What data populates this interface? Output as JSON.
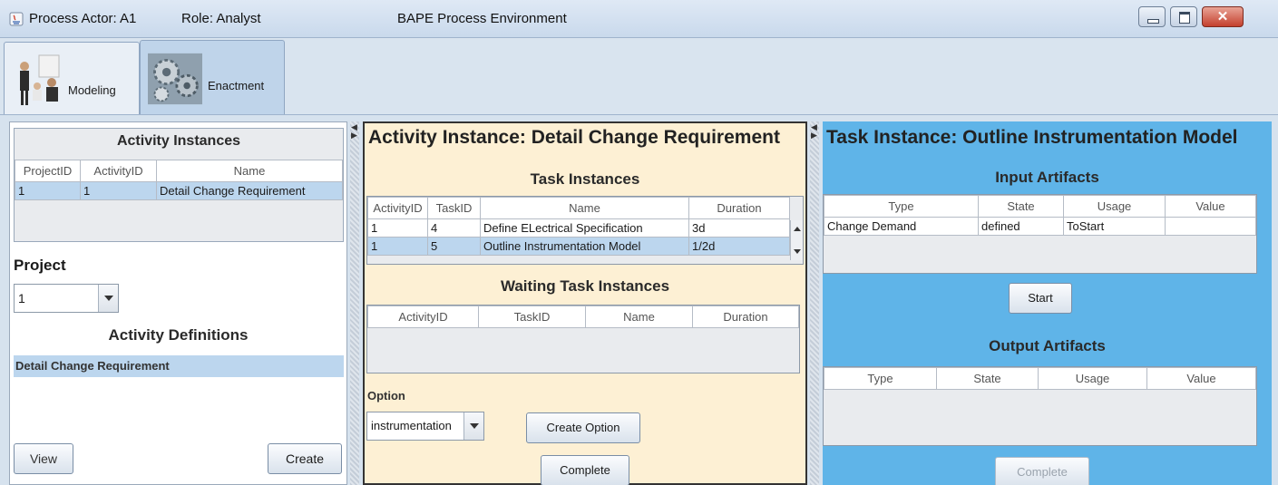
{
  "window": {
    "actor": "Process Actor: A1",
    "role": "Role: Analyst",
    "title": "BAPE Process Environment"
  },
  "mode_tabs": [
    {
      "label": "Modeling",
      "icon": "meeting-people-icon"
    },
    {
      "label": "Enactment",
      "icon": "gears-icon",
      "selected": true
    }
  ],
  "left": {
    "activity_instances_title": "Activity Instances",
    "columns": [
      "ProjectID",
      "ActivityID",
      "Name"
    ],
    "rows": [
      [
        "1",
        "1",
        "Detail Change Requirement"
      ]
    ],
    "project_label": "Project",
    "project_value": "1",
    "activity_definitions_title": "Activity Definitions",
    "definitions": [
      "Detail Change Requirement"
    ],
    "view_label": "View",
    "create_label": "Create"
  },
  "middle": {
    "title": "Activity Instance: Detail Change Requirement",
    "task_instances_title": "Task Instances",
    "task_columns": [
      "ActivityID",
      "TaskID",
      "Name",
      "Duration"
    ],
    "task_rows": [
      [
        "1",
        "4",
        "Define ELectrical Specification",
        "3d"
      ],
      [
        "1",
        "5",
        "Outline Instrumentation Model",
        "1/2d"
      ]
    ],
    "waiting_title": "Waiting Task Instances",
    "waiting_columns": [
      "ActivityID",
      "TaskID",
      "Name",
      "Duration"
    ],
    "option_label": "Option",
    "option_value": "instrumentation",
    "create_option_label": "Create Option",
    "complete_label": "Complete"
  },
  "right": {
    "title": "Task Instance: Outline Instrumentation Model",
    "input_title": "Input Artifacts",
    "input_columns": [
      "Type",
      "State",
      "Usage",
      "Value"
    ],
    "input_rows": [
      [
        "Change Demand",
        "defined",
        "ToStart",
        ""
      ]
    ],
    "start_label": "Start",
    "output_title": "Output Artifacts",
    "output_columns": [
      "Type",
      "State",
      "Usage",
      "Value"
    ],
    "complete_label": "Complete"
  },
  "colors": {
    "middle_panel_bg": "#fdf0d4",
    "right_panel_bg": "#5fb4e8",
    "selection": "#bcd6ee"
  }
}
